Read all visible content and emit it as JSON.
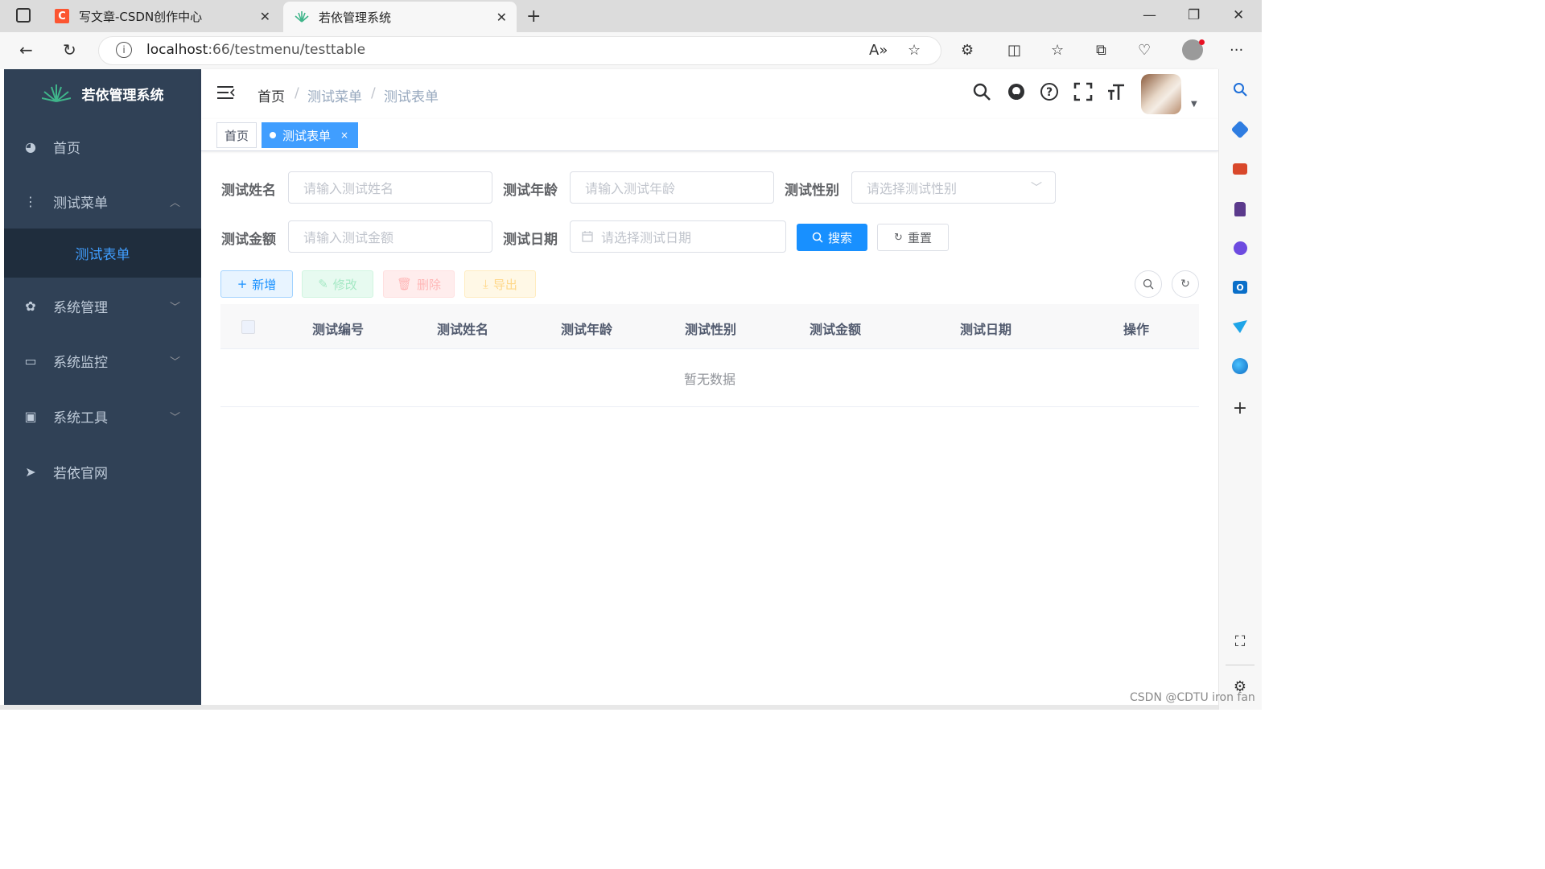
{
  "browser": {
    "tabs": [
      {
        "title": "写文章-CSDN创作中心",
        "favicon": "csdn-logo",
        "active": false
      },
      {
        "title": "若依管理系统",
        "favicon": "ruoyi-leaf-logo",
        "active": true
      }
    ],
    "tab_close": "✕",
    "new_tab": "+",
    "url_host": "localhost",
    "url_path": ":66/testmenu/testtable"
  },
  "sidebar": {
    "logo_title": "若依管理系统",
    "items": [
      {
        "label": "首页",
        "icon": "dashboard-icon"
      },
      {
        "label": "测试菜单",
        "icon": "tree-icon",
        "expanded": true
      },
      {
        "label": "测试表单",
        "active": true
      },
      {
        "label": "系统管理",
        "icon": "gear-icon"
      },
      {
        "label": "系统监控",
        "icon": "monitor-icon"
      },
      {
        "label": "系统工具",
        "icon": "toolbox-icon"
      },
      {
        "label": "若依官网",
        "icon": "paper-plane-icon"
      }
    ]
  },
  "navbar": {
    "breadcrumb": [
      "首页",
      "测试菜单",
      "测试表单"
    ],
    "breadcrumb_sep": "/"
  },
  "tags": [
    {
      "label": "首页",
      "active": false
    },
    {
      "label": "测试表单",
      "active": true,
      "close": "×"
    }
  ],
  "search_form": {
    "name_label": "测试姓名",
    "name_placeholder": "请输入测试姓名",
    "age_label": "测试年龄",
    "age_placeholder": "请输入测试年龄",
    "gender_label": "测试性别",
    "gender_placeholder": "请选择测试性别",
    "amount_label": "测试金额",
    "amount_placeholder": "请输入测试金额",
    "date_label": "测试日期",
    "date_placeholder": "请选择测试日期",
    "search_button": "搜索",
    "reset_button": "重置"
  },
  "toolbar": {
    "add": "新增",
    "edit": "修改",
    "delete": "删除",
    "export": "导出"
  },
  "table": {
    "columns": [
      "测试编号",
      "测试姓名",
      "测试年龄",
      "测试性别",
      "测试金额",
      "测试日期",
      "操作"
    ],
    "empty_text": "暂无数据"
  },
  "watermark": "CSDN @CDTU iron fan",
  "colors": {
    "sidebar_bg": "#304156",
    "sidebar_sub_bg": "#1f2d3d",
    "primary": "#1890ff",
    "active_text": "#409eff"
  }
}
